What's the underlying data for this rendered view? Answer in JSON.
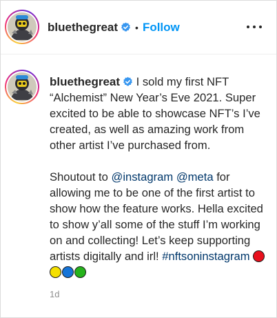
{
  "header": {
    "username": "bluethegreat",
    "dot": "•",
    "follow_label": "Follow",
    "more_icon": "more-horizontal-icon"
  },
  "post": {
    "username": "bluethegreat",
    "caption_line1_rest": " I sold my first NFT “Alchemist” New Year’s Eve 2021. Super excited to be able to showcase NFT’s I’ve created, as well as amazing work from other artist I’ve purchased from.",
    "shoutout_prefix": "Shoutout to ",
    "mention1": "@instagram",
    "mention_sep": " ",
    "mention2": "@meta",
    "shoutout_rest": " for allowing me to be one of the first artist to show how the feature works. Hella excited to show y’all some of the stuff I’m working on and collecting! Let’s keep supporting artists digitally and irl!",
    "hashtag": "#nftsoninstagram",
    "emoji_colors": [
      "#e8101d",
      "#f5e000",
      "#1574d8",
      "#26b31c"
    ],
    "timestamp": "1d"
  },
  "colors": {
    "link": "#0095f6",
    "mention": "#00376b",
    "verified": "#3897f0"
  }
}
